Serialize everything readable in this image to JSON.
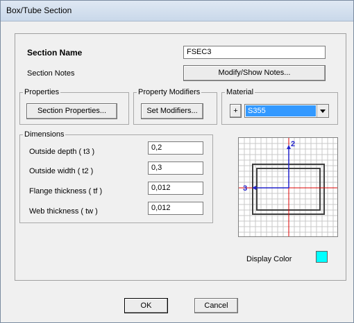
{
  "window": {
    "title": "Box/Tube Section"
  },
  "section": {
    "name_label": "Section Name",
    "name_value": "FSEC3",
    "notes_label": "Section Notes",
    "notes_button": "Modify/Show Notes..."
  },
  "properties": {
    "legend": "Properties",
    "button": "Section Properties..."
  },
  "modifiers": {
    "legend": "Property Modifiers",
    "button": "Set Modifiers..."
  },
  "material": {
    "legend": "Material",
    "plus": "+",
    "selected": "S355"
  },
  "dimensions": {
    "legend": "Dimensions",
    "rows": [
      {
        "label": "Outside depth  ( t3 )",
        "value": "0,2"
      },
      {
        "label": "Outside width  ( t2 )",
        "value": "0,3"
      },
      {
        "label": "Flange thickness  ( tf )",
        "value": "0,012"
      },
      {
        "label": "Web thickness  ( tw )",
        "value": "0,012"
      }
    ]
  },
  "preview": {
    "axis_vertical": "2",
    "axis_horizontal": "3"
  },
  "display_color": {
    "label": "Display Color",
    "color": "#00ffff"
  },
  "footer": {
    "ok": "OK",
    "cancel": "Cancel"
  },
  "colors": {
    "axis_blue": "#2222cc",
    "axis_red": "#dd0000",
    "selection_blue": "#3399ff"
  }
}
